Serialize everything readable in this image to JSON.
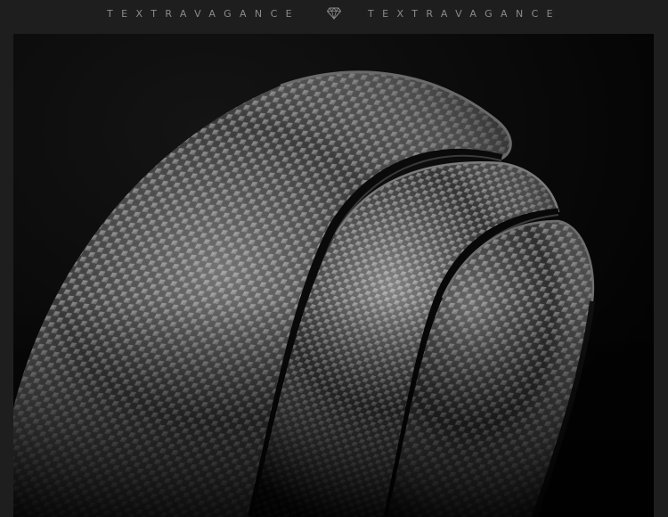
{
  "header": {
    "brand_left": "TEXTRAVAGANCE",
    "brand_right": "TEXTRAVAGANCE",
    "logo_icon": "diamond-icon"
  },
  "photo": {
    "subject": "textured-leather-belt-close-up",
    "colors": {
      "page_background": "#1e1e1e",
      "panel_background": "#050505",
      "brand_text": "#8a8a8a"
    }
  }
}
